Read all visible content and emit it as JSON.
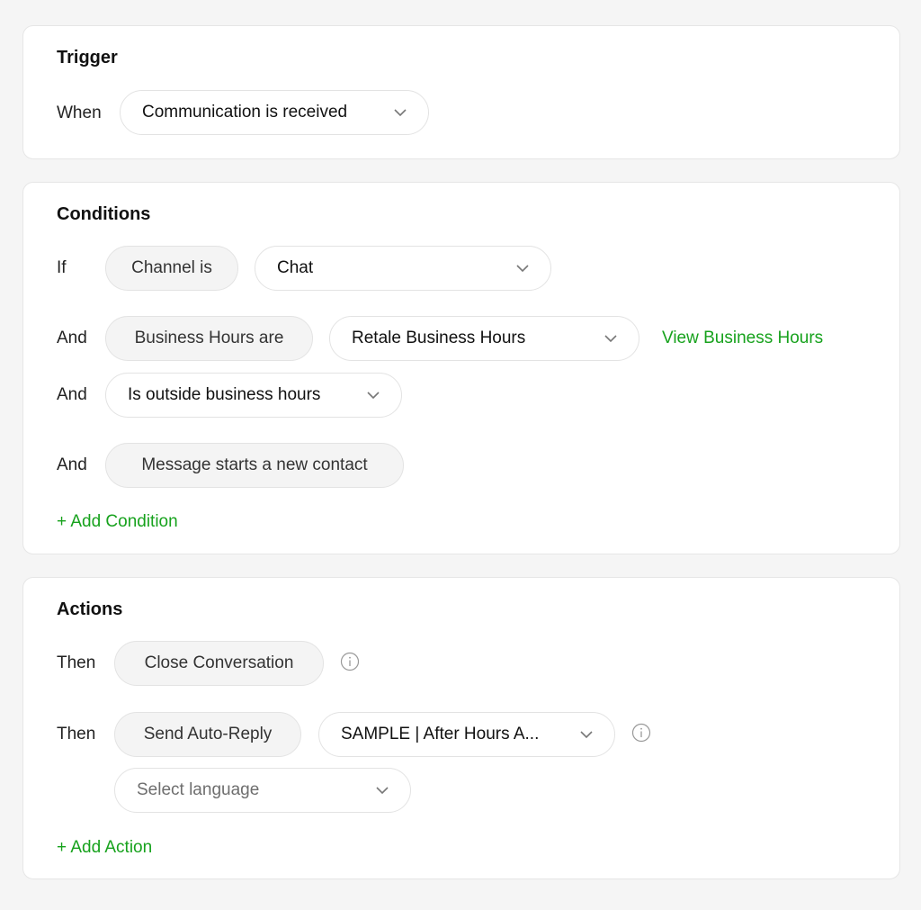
{
  "colors": {
    "accent": "#17a21d",
    "pill_bg": "#f4f4f4",
    "page_bg": "#f5f5f5"
  },
  "trigger": {
    "title": "Trigger",
    "when_label": "When",
    "event_select": "Communication is received"
  },
  "conditions": {
    "title": "Conditions",
    "rows": [
      {
        "prefix": "If",
        "field": "Channel is",
        "value": "Chat"
      },
      {
        "prefix": "And",
        "field": "Business Hours are",
        "value": "Retale Business Hours",
        "link": "View Business Hours"
      },
      {
        "prefix": "And",
        "value": "Is outside business hours"
      },
      {
        "prefix": "And",
        "field": "Message starts a new contact"
      }
    ],
    "add_label": "+ Add Condition"
  },
  "actions": {
    "title": "Actions",
    "rows": [
      {
        "prefix": "Then",
        "action": "Close Conversation"
      },
      {
        "prefix": "Then",
        "action": "Send Auto-Reply",
        "value": "SAMPLE | After Hours A...",
        "language_placeholder": "Select language"
      }
    ],
    "add_label": "+ Add Action"
  }
}
